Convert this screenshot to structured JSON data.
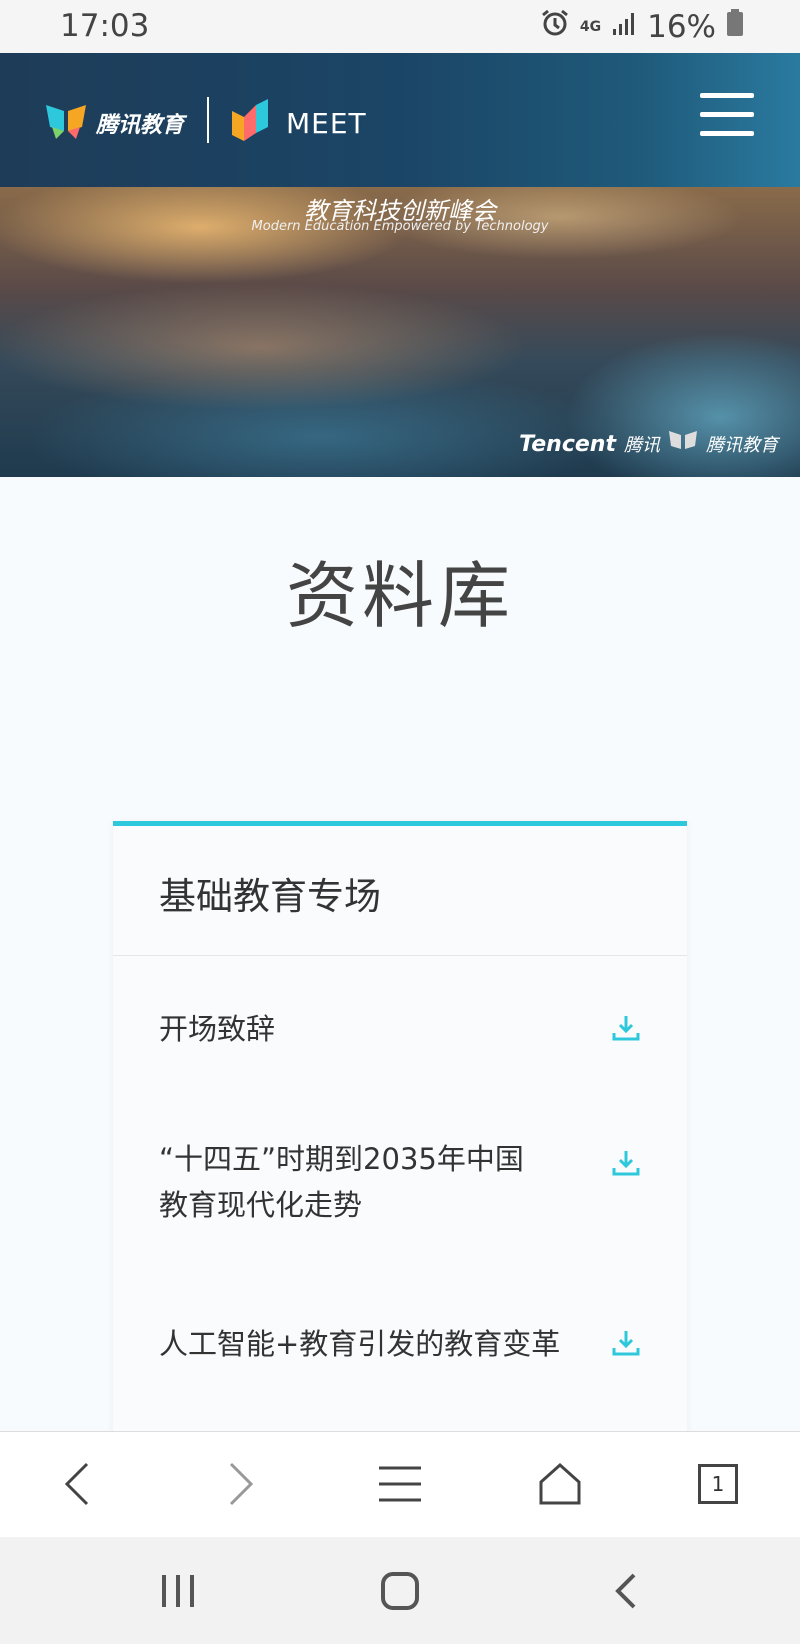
{
  "status_bar": {
    "time": "17:03",
    "network": "4G",
    "battery": "16%"
  },
  "header": {
    "logo_text": "腾讯教育",
    "meet_text": "MEET"
  },
  "banner": {
    "title": "教育科技创新峰会",
    "subtitle": "Modern Education Empowered by Technology",
    "brand_en": "Tencent",
    "brand_cn": "腾讯",
    "brand_edu": "腾讯教育"
  },
  "page": {
    "title": "资料库"
  },
  "card": {
    "title": "基础教育专场",
    "items": [
      {
        "label": "开场致辞"
      },
      {
        "label": "“十四五”时期到2035年中国教育现代化走势"
      },
      {
        "label": "人工智能+教育引发的教育变革"
      }
    ]
  },
  "browser_toolbar": {
    "tab_count": "1"
  },
  "colors": {
    "accent": "#2ec8dc",
    "header_bg": "#1e3c58"
  }
}
